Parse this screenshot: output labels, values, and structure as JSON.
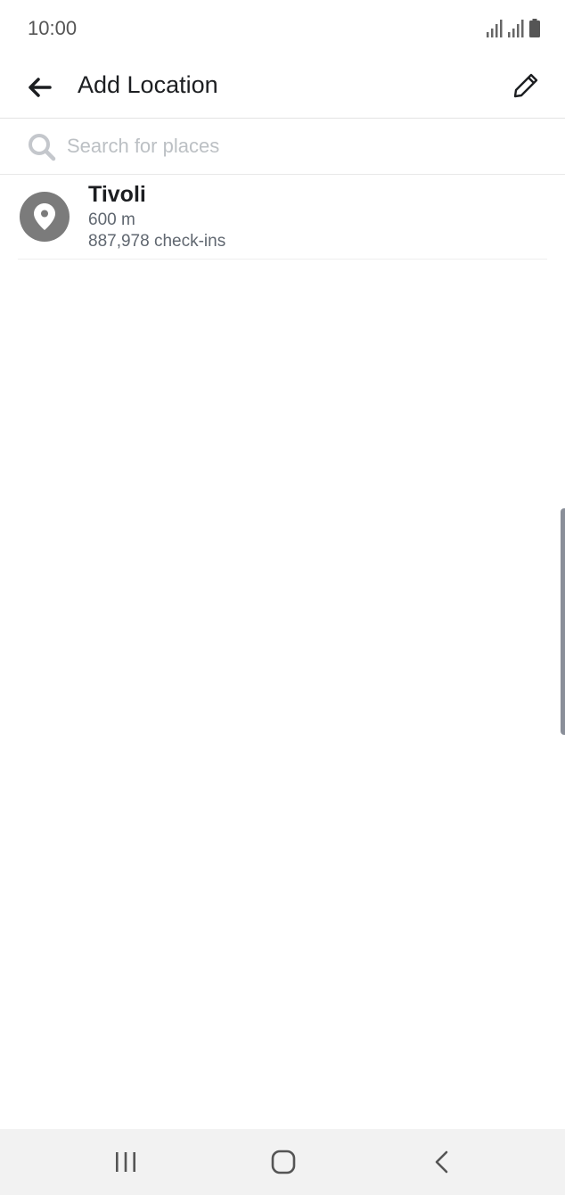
{
  "status_bar": {
    "time": "10:00",
    "icons": [
      "signal-icon",
      "signal-icon",
      "battery-icon"
    ]
  },
  "header": {
    "title": "Add Location",
    "back_icon": "arrow-left-icon",
    "edit_icon": "pencil-icon"
  },
  "search": {
    "placeholder": "Search for places",
    "value": "",
    "icon": "search-icon"
  },
  "places": [
    {
      "name": "Tivoli",
      "distance": "600 m",
      "checkins": "887,978 check-ins",
      "icon": "location-pin-icon"
    }
  ],
  "nav_bar": {
    "buttons": [
      "recent-apps-icon",
      "home-icon",
      "back-icon"
    ]
  },
  "colors": {
    "avatar_bg": "#7b7b7b",
    "title_text": "#1c1e21",
    "secondary_text": "#606770",
    "placeholder_text": "#bcc0c4",
    "nav_bg": "#f2f2f2"
  }
}
